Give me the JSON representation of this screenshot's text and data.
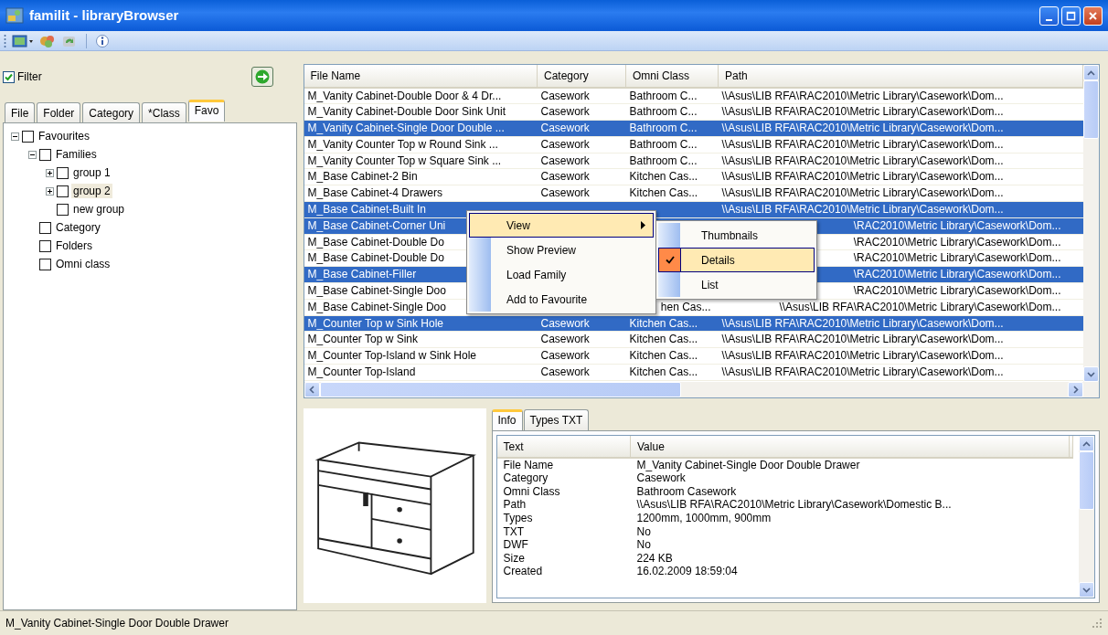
{
  "window": {
    "title": "familit - libraryBrowser"
  },
  "filter": {
    "label": "Filter",
    "checked": true
  },
  "left_tabs": [
    {
      "label": "File",
      "selected": false
    },
    {
      "label": "Folder",
      "selected": false
    },
    {
      "label": "Category",
      "selected": false
    },
    {
      "label": "*Class",
      "selected": false
    },
    {
      "label": "Favo",
      "selected": true
    }
  ],
  "tree": [
    {
      "label": "Favourites",
      "expanded": true,
      "checked": false,
      "selected": false,
      "children": [
        {
          "label": "Families",
          "expanded": true,
          "checked": false,
          "selected": false,
          "children": [
            {
              "label": "group 1",
              "expanded": false,
              "checked": false,
              "selected": false
            },
            {
              "label": "group 2",
              "expanded": false,
              "checked": false,
              "selected": true
            },
            {
              "label": "new group",
              "checked": false,
              "selected": false
            }
          ]
        },
        {
          "label": "Category",
          "checked": false,
          "selected": false
        },
        {
          "label": "Folders",
          "checked": false,
          "selected": false
        },
        {
          "label": "Omni class",
          "checked": false,
          "selected": false
        }
      ]
    }
  ],
  "file_list": {
    "columns": [
      "File Name",
      "Category",
      "Omni Class",
      "Path"
    ],
    "rows": [
      {
        "cells": [
          "M_Vanity Cabinet-Double Door & 4 Dr...",
          "Casework",
          "Bathroom C...",
          "\\\\Asus\\LIB RFA\\RAC2010\\Metric Library\\Casework\\Dom..."
        ],
        "selected": false,
        "covered": false
      },
      {
        "cells": [
          "M_Vanity Cabinet-Double Door Sink Unit",
          "Casework",
          "Bathroom C...",
          "\\\\Asus\\LIB RFA\\RAC2010\\Metric Library\\Casework\\Dom..."
        ],
        "selected": false,
        "covered": false
      },
      {
        "cells": [
          "M_Vanity Cabinet-Single Door Double ...",
          "Casework",
          "Bathroom C...",
          "\\\\Asus\\LIB RFA\\RAC2010\\Metric Library\\Casework\\Dom..."
        ],
        "selected": true,
        "covered": false
      },
      {
        "cells": [
          "M_Vanity Counter Top w Round Sink ...",
          "Casework",
          "Bathroom C...",
          "\\\\Asus\\LIB RFA\\RAC2010\\Metric Library\\Casework\\Dom..."
        ],
        "selected": false,
        "covered": false
      },
      {
        "cells": [
          "M_Vanity Counter Top w Square Sink ...",
          "Casework",
          "Bathroom C...",
          "\\\\Asus\\LIB RFA\\RAC2010\\Metric Library\\Casework\\Dom..."
        ],
        "selected": false,
        "covered": false
      },
      {
        "cells": [
          "M_Base Cabinet-2 Bin",
          "Casework",
          "Kitchen Cas...",
          "\\\\Asus\\LIB RFA\\RAC2010\\Metric Library\\Casework\\Dom..."
        ],
        "selected": false,
        "covered": false
      },
      {
        "cells": [
          "M_Base Cabinet-4 Drawers",
          "Casework",
          "Kitchen Cas...",
          "\\\\Asus\\LIB RFA\\RAC2010\\Metric Library\\Casework\\Dom..."
        ],
        "selected": false,
        "covered": false
      },
      {
        "cells": [
          "M_Base Cabinet-Built In",
          null,
          null,
          "\\\\Asus\\LIB RFA\\RAC2010\\Metric Library\\Casework\\Dom..."
        ],
        "selected": true,
        "covered": false
      },
      {
        "cells": [
          "M_Base Cabinet-Corner Uni",
          null,
          null,
          "\\RAC2010\\Metric Library\\Casework\\Dom..."
        ],
        "selected": true,
        "covered": true
      },
      {
        "cells": [
          "M_Base Cabinet-Double Do",
          null,
          null,
          "\\RAC2010\\Metric Library\\Casework\\Dom..."
        ],
        "selected": false,
        "covered": true
      },
      {
        "cells": [
          "M_Base Cabinet-Double Do",
          null,
          null,
          "\\RAC2010\\Metric Library\\Casework\\Dom..."
        ],
        "selected": false,
        "covered": true
      },
      {
        "cells": [
          "M_Base Cabinet-Filler",
          null,
          null,
          "\\RAC2010\\Metric Library\\Casework\\Dom..."
        ],
        "selected": true,
        "covered": true
      },
      {
        "cells": [
          "M_Base Cabinet-Single Doo",
          null,
          null,
          "\\RAC2010\\Metric Library\\Casework\\Dom..."
        ],
        "selected": false,
        "covered": true
      },
      {
        "cells": [
          "M_Base Cabinet-Single Doo",
          null,
          "hen Cas...",
          "\\\\Asus\\LIB RFA\\RAC2010\\Metric Library\\Casework\\Dom..."
        ],
        "selected": false,
        "covered": true
      },
      {
        "cells": [
          "M_Counter Top w Sink Hole",
          "Casework",
          "Kitchen Cas...",
          "\\\\Asus\\LIB RFA\\RAC2010\\Metric Library\\Casework\\Dom..."
        ],
        "selected": true,
        "covered": false
      },
      {
        "cells": [
          "M_Counter Top w Sink",
          "Casework",
          "Kitchen Cas...",
          "\\\\Asus\\LIB RFA\\RAC2010\\Metric Library\\Casework\\Dom..."
        ],
        "selected": false,
        "covered": false
      },
      {
        "cells": [
          "M_Counter Top-Island w Sink Hole",
          "Casework",
          "Kitchen Cas...",
          "\\\\Asus\\LIB RFA\\RAC2010\\Metric Library\\Casework\\Dom..."
        ],
        "selected": false,
        "covered": false
      },
      {
        "cells": [
          "M_Counter Top-Island",
          "Casework",
          "Kitchen Cas...",
          "\\\\Asus\\LIB RFA\\RAC2010\\Metric Library\\Casework\\Dom..."
        ],
        "selected": false,
        "covered": false
      }
    ]
  },
  "context_menu": {
    "items": [
      {
        "label": "View",
        "highlighted": true,
        "submenu": true
      },
      {
        "label": "Show Preview",
        "highlighted": false,
        "submenu": false
      },
      {
        "label": "Load Family",
        "highlighted": false,
        "submenu": false
      },
      {
        "label": "Add to Favourite",
        "highlighted": false,
        "submenu": false
      }
    ]
  },
  "submenu": {
    "items": [
      {
        "label": "Thumbnails",
        "checked": false,
        "highlighted": false
      },
      {
        "label": "Details",
        "checked": true,
        "highlighted": true
      },
      {
        "label": "List",
        "checked": false,
        "highlighted": false
      }
    ]
  },
  "info_tabs": [
    {
      "label": "Info",
      "selected": true
    },
    {
      "label": "Types TXT",
      "selected": false
    }
  ],
  "info_list": {
    "columns": [
      "Text",
      "Value"
    ],
    "rows": [
      [
        "File Name",
        "M_Vanity Cabinet-Single Door Double Drawer"
      ],
      [
        "Category",
        "Casework"
      ],
      [
        "Omni Class",
        "Bathroom Casework"
      ],
      [
        "Path",
        "\\\\Asus\\LIB RFA\\RAC2010\\Metric Library\\Casework\\Domestic B..."
      ],
      [
        "Types",
        "1200mm, 1000mm, 900mm"
      ],
      [
        "TXT",
        "No"
      ],
      [
        "DWF",
        "No"
      ],
      [
        "Size",
        "224 KB"
      ],
      [
        "Created",
        "16.02.2009 18:59:04"
      ]
    ]
  },
  "status_bar": {
    "text": "M_Vanity Cabinet-Single Door Double Drawer"
  }
}
